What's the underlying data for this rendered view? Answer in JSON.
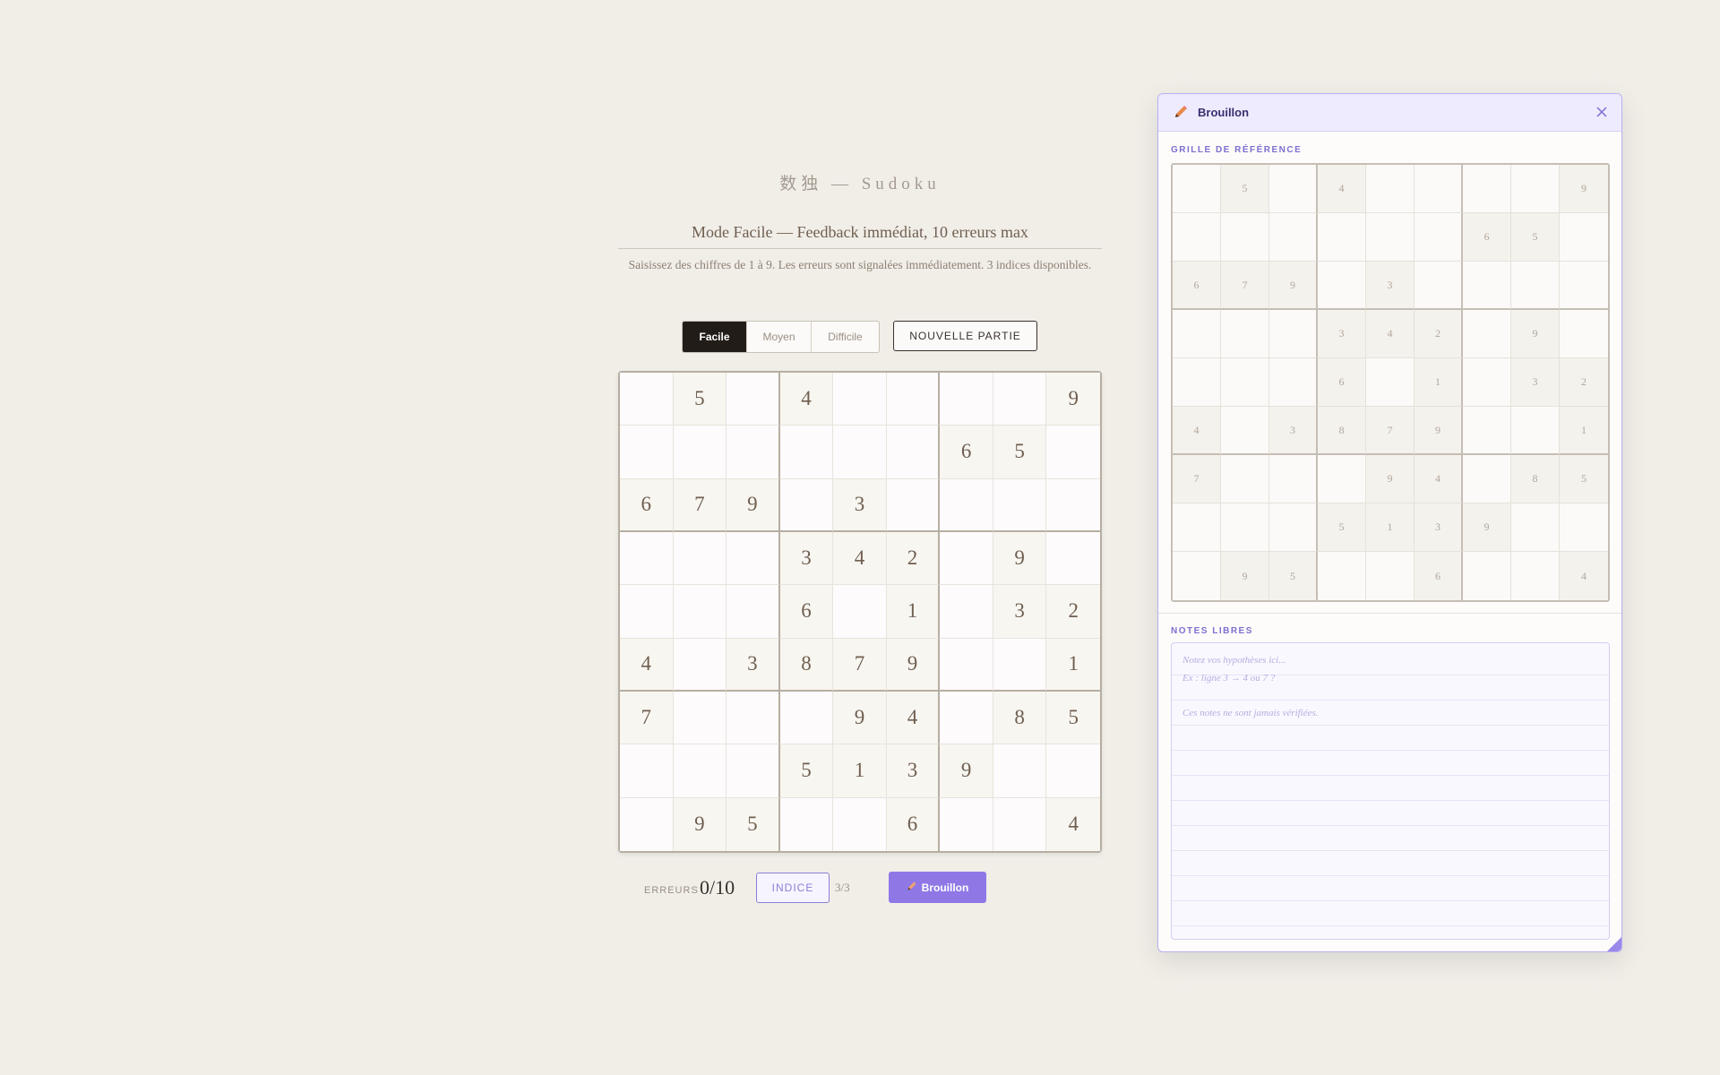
{
  "app": {
    "title": "数独 — Sudoku",
    "mode_title": "Mode Facile — Feedback immédiat, 10 erreurs max",
    "mode_description": "Saisissez des chiffres de 1 à 9. Les erreurs sont signalées immédiatement. 3 indices disponibles."
  },
  "difficulty": {
    "options": [
      "Facile",
      "Moyen",
      "Difficile"
    ],
    "selected": "Facile"
  },
  "new_game_label": "NOUVELLE PARTIE",
  "board": [
    [
      "",
      "5",
      "",
      "4",
      "",
      "",
      "",
      "",
      "9"
    ],
    [
      "",
      "",
      "",
      "",
      "",
      "",
      "6",
      "5",
      ""
    ],
    [
      "6",
      "7",
      "9",
      "",
      "3",
      "",
      "",
      "",
      ""
    ],
    [
      "",
      "",
      "",
      "3",
      "4",
      "2",
      "",
      "9",
      ""
    ],
    [
      "",
      "",
      "",
      "6",
      "",
      "1",
      "",
      "3",
      "2"
    ],
    [
      "4",
      "",
      "3",
      "8",
      "7",
      "9",
      "",
      "",
      "1"
    ],
    [
      "7",
      "",
      "",
      "",
      "9",
      "4",
      "",
      "8",
      "5"
    ],
    [
      "",
      "",
      "",
      "5",
      "1",
      "3",
      "9",
      "",
      ""
    ],
    [
      "",
      "9",
      "5",
      "",
      "",
      "6",
      "",
      "",
      "4"
    ]
  ],
  "status": {
    "errors_label": "ERREURS",
    "errors_value": "0/10",
    "hint_label": "INDICE",
    "hint_count": "3/3",
    "draft_label": "Brouillon"
  },
  "draft_panel": {
    "title": "Brouillon",
    "reference_label": "GRILLE DE RÉFÉRENCE",
    "notes_label": "NOTES LIBRES",
    "notes_placeholder_lines": [
      "Notez vos hypothèses ici...",
      "Ex : ligne 3 → 4 ou 7 ?",
      "",
      "Ces notes ne sont jamais vérifiées."
    ]
  },
  "colors": {
    "background": "#f1eee8",
    "accent": "#8f78e6",
    "active_difficulty": "#221c19",
    "panel_header": "#efebff"
  },
  "icons": {
    "draft": "pencil-icon",
    "close": "close-icon"
  }
}
